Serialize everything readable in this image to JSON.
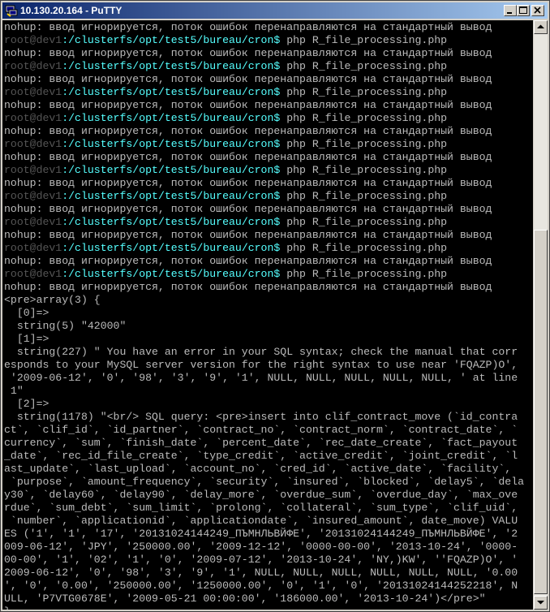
{
  "window": {
    "title": "10.130.20.164 - PuTTY",
    "icon": "putty-icon",
    "controls": [
      "minimize-icon",
      "maximize-icon",
      "close-icon"
    ]
  },
  "colors": {
    "background": "#000000",
    "text": "#bbbbbb",
    "prompt_user": "#555555",
    "prompt_path": "#55ffff",
    "cursor": "#00ff00"
  },
  "terminal": {
    "lines": [
      {
        "text": "nohup: ввод игнорируется, поток ошибок перенаправляются на стандартный вывод"
      },
      {
        "user": "root@dev1",
        "path": ":/clusterfs/opt/test5/bureau/cron$",
        "cmd": " php R_file_processing.php"
      },
      {
        "text": "nohup: ввод игнорируется, поток ошибок перенаправляются на стандартный вывод"
      },
      {
        "user": "root@dev1",
        "path": ":/clusterfs/opt/test5/bureau/cron$",
        "cmd": " php R_file_processing.php"
      },
      {
        "text": "nohup: ввод игнорируется, поток ошибок перенаправляются на стандартный вывод"
      },
      {
        "user": "root@dev1",
        "path": ":/clusterfs/opt/test5/bureau/cron$",
        "cmd": " php R_file_processing.php"
      },
      {
        "text": "nohup: ввод игнорируется, поток ошибок перенаправляются на стандартный вывод"
      },
      {
        "user": "root@dev1",
        "path": ":/clusterfs/opt/test5/bureau/cron$",
        "cmd": " php R_file_processing.php"
      },
      {
        "text": "nohup: ввод игнорируется, поток ошибок перенаправляются на стандартный вывод"
      },
      {
        "user": "root@dev1",
        "path": ":/clusterfs/opt/test5/bureau/cron$",
        "cmd": " php R_file_processing.php"
      },
      {
        "text": "nohup: ввод игнорируется, поток ошибок перенаправляются на стандартный вывод"
      },
      {
        "user": "root@dev1",
        "path": ":/clusterfs/opt/test5/bureau/cron$",
        "cmd": " php R_file_processing.php"
      },
      {
        "text": "nohup: ввод игнорируется, поток ошибок перенаправляются на стандартный вывод"
      },
      {
        "user": "root@dev1",
        "path": ":/clusterfs/opt/test5/bureau/cron$",
        "cmd": " php R_file_processing.php"
      },
      {
        "text": "nohup: ввод игнорируется, поток ошибок перенаправляются на стандартный вывод"
      },
      {
        "user": "root@dev1",
        "path": ":/clusterfs/opt/test5/bureau/cron$",
        "cmd": " php R_file_processing.php"
      },
      {
        "text": "nohup: ввод игнорируется, поток ошибок перенаправляются на стандартный вывод"
      },
      {
        "user": "root@dev1",
        "path": ":/clusterfs/opt/test5/bureau/cron$",
        "cmd": " php R_file_processing.php"
      },
      {
        "text": "nohup: ввод игнорируется, поток ошибок перенаправляются на стандартный вывод"
      },
      {
        "user": "root@dev1",
        "path": ":/clusterfs/opt/test5/bureau/cron$",
        "cmd": " php R_file_processing.php"
      },
      {
        "text": "nohup: ввод игнорируется, поток ошибок перенаправляются на стандартный вывод"
      },
      {
        "text": "<pre>array(3) {"
      },
      {
        "text": "  [0]=>"
      },
      {
        "text": "  string(5) \"42000\""
      },
      {
        "text": "  [1]=>"
      },
      {
        "text": "  string(227) \" You have an error in your SQL syntax; check the manual that corr"
      },
      {
        "text": "esponds to your MySQL server version for the right syntax to use near 'FQAZP)O',"
      },
      {
        "text": " '2009-06-12', '0', '98', '3', '9', '1', NULL, NULL, NULL, NULL, NULL, ' at line"
      },
      {
        "text": " 1\""
      },
      {
        "text": "  [2]=>"
      },
      {
        "text": "  string(1178) \"<br/> SQL query: <pre>insert into clif_contract_move (`id_contra"
      },
      {
        "text": "ct`, `clif_id`, `id_partner`, `contract_no`, `contract_norm`, `contract_date`, `"
      },
      {
        "text": "currency`, `sum`, `finish_date`, `percent_date`, `rec_date_create`, `fact_payout"
      },
      {
        "text": "_date`, `rec_id_file_create`, `type_credit`, `active_credit`, `joint_credit`, `l"
      },
      {
        "text": "ast_update`, `last_upload`, `account_no`, `cred_id`, `active_date`, `facility`,"
      },
      {
        "text": " `purpose`, `amount_frequency`, `security`, `insured`, `blocked`, `delay5`, `dela"
      },
      {
        "text": "y30`, `delay60`, `delay90`, `delay_more`, `overdue_sum`, `overdue_day`, `max_ove"
      },
      {
        "text": "rdue`, `sum_debt`, `sum_limit`, `prolong`, `collateral`, `sum_type`, `clif_uid`,"
      },
      {
        "text": " `number`, `applicationid`, `applicationdate`, `insured_amount`, date_move) VALU"
      },
      {
        "text": "ES ('1', '1', '17', '20131024144249_ПЪМНЛЬВЙФЕ', '20131024144249_ПЪМНЛЬВЙФЕ', '2"
      },
      {
        "text": "009-06-12', 'JPY', '250000.00', '2009-12-12', '0000-00-00', '2013-10-24', '0000-"
      },
      {
        "text": "00-00', '1', '02', '1', '0', '2009-07-12', '2013-10-24', 'NY,)KW', ''FQAZP)O', '"
      },
      {
        "text": "2009-06-12', '0', '98', '3', '9', '1', NULL, NULL, NULL, NULL, NULL, NULL, '0.00"
      },
      {
        "text": "', '0', '0.00', '250000.00', '1250000.00', '0', '1', '0', '20131024144252218', N"
      },
      {
        "text": "ULL, 'P7VTG0678E', '2009-05-21 00:00:00', '186000.00', '2013-10-24')</pre>\""
      },
      {
        "text": "}"
      },
      {
        "user": "root@dev1",
        "path": ":/clusterfs/opt/test5/bureau/cron$",
        "cmd": "",
        "cursor": true
      }
    ]
  }
}
